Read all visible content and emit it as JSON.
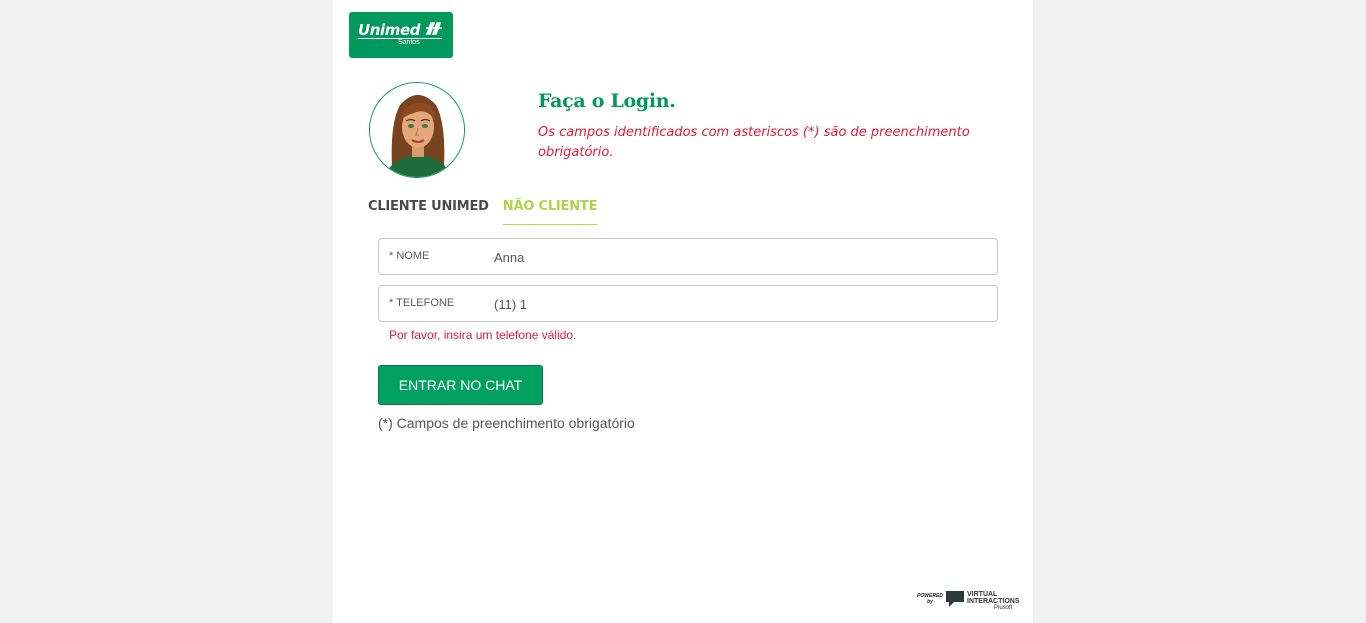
{
  "logo": {
    "brand": "Unimed",
    "city": "Santos"
  },
  "header": {
    "title": "Faça o Login.",
    "subtitle": "Os campos identificados com asteriscos (*) são de preenchimento obrigatório."
  },
  "tabs": [
    {
      "label": "CLIENTE UNIMED",
      "active": false
    },
    {
      "label": "NÃO CLIENTE",
      "active": true
    }
  ],
  "form": {
    "nome": {
      "label": "* NOME",
      "value": "Anna"
    },
    "telefone": {
      "label": "* TELEFONE",
      "value": "(11) 1"
    },
    "error": "Por favor, insira um telefone válido.",
    "submit_label": "ENTRAR NO CHAT",
    "required_note": "(*) Campos de preenchimento obrigatório"
  },
  "footer": {
    "powered": "POWERED by",
    "brand_line1": "VIRTUAL",
    "brand_line2": "INTERACTIONS",
    "brand_sub": "Plusoft"
  },
  "colors": {
    "brand_green": "#00995d",
    "tab_active": "#b1d34b",
    "error_red": "#e6183b",
    "background": "#f1f1f1"
  },
  "icons": [
    "unimed-logo-icon",
    "avatar-icon",
    "virtual-interactions-icon"
  ]
}
